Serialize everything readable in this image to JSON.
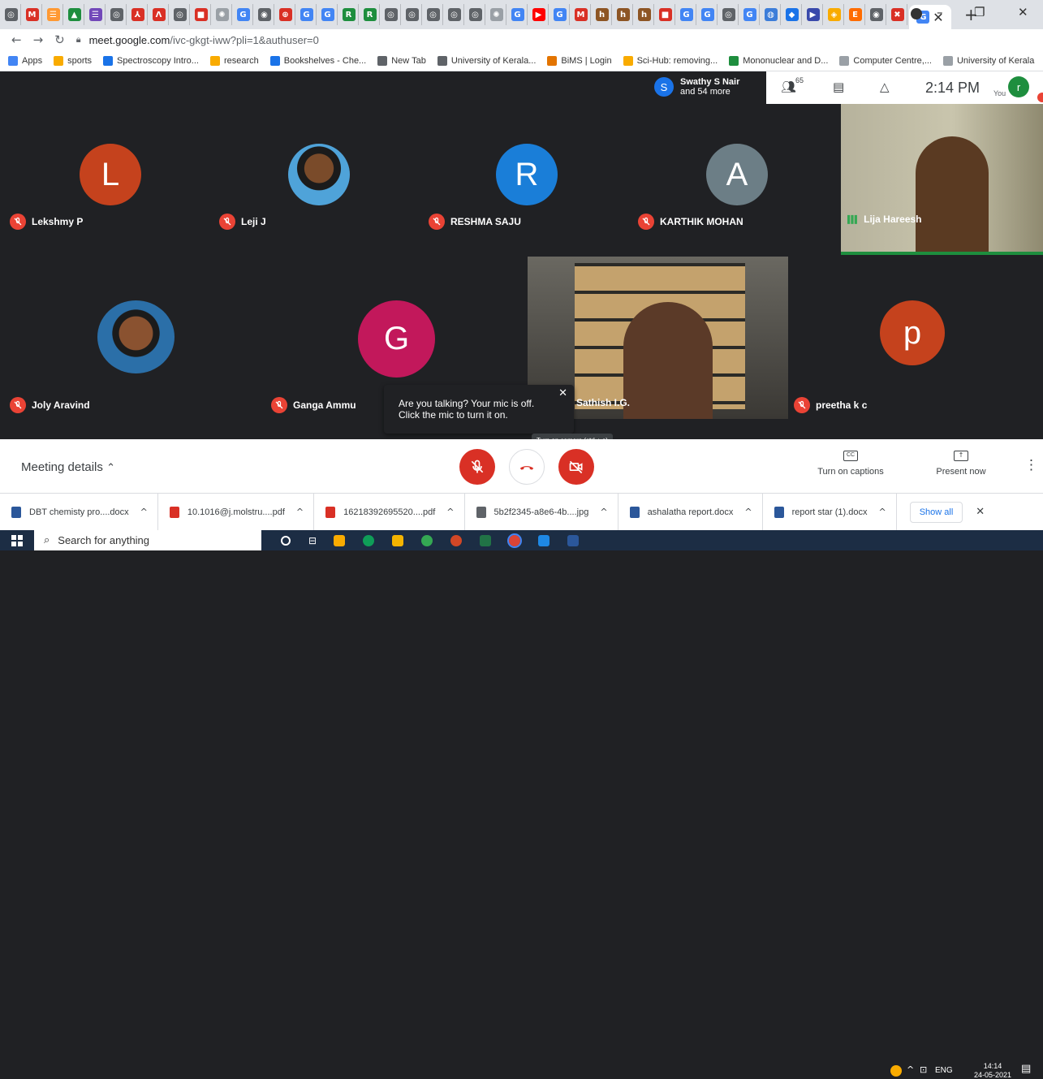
{
  "browser": {
    "tab_favicons": [
      {
        "icon": "chrome-icon",
        "color": "#5f6368",
        "glyph": "◎"
      },
      {
        "icon": "gmail-icon",
        "color": "#d93025",
        "glyph": "M"
      },
      {
        "icon": "india-flag-icon",
        "color": "#ff9933",
        "glyph": "☰"
      },
      {
        "icon": "drive-icon",
        "color": "#1e8e3e",
        "glyph": "▲"
      },
      {
        "icon": "forms-icon",
        "color": "#7248b9",
        "glyph": "☰"
      },
      {
        "icon": "chrome-icon",
        "color": "#5f6368",
        "glyph": "◎"
      },
      {
        "icon": "pdf-icon",
        "color": "#d93025",
        "glyph": "⅄"
      },
      {
        "icon": "acrobat-icon",
        "color": "#d93025",
        "glyph": "Λ"
      },
      {
        "icon": "chrome-icon",
        "color": "#5f6368",
        "glyph": "◎"
      },
      {
        "icon": "news-icon",
        "color": "#d93025",
        "glyph": "■"
      },
      {
        "icon": "seal-icon",
        "color": "#9aa0a6",
        "glyph": "✺"
      },
      {
        "icon": "google-icon",
        "color": "#4285f4",
        "glyph": "G"
      },
      {
        "icon": "meet-icon",
        "color": "#5f6368",
        "glyph": "◉"
      },
      {
        "icon": "seal-icon",
        "color": "#d93025",
        "glyph": "⊕"
      },
      {
        "icon": "google-icon",
        "color": "#4285f4",
        "glyph": "G"
      },
      {
        "icon": "google-icon",
        "color": "#4285f4",
        "glyph": "G"
      },
      {
        "icon": "researchgate-icon",
        "color": "#1e8e3e",
        "glyph": "R"
      },
      {
        "icon": "researchgate-icon",
        "color": "#1e8e3e",
        "glyph": "R"
      },
      {
        "icon": "chrome-icon",
        "color": "#5f6368",
        "glyph": "◎"
      },
      {
        "icon": "chrome-icon",
        "color": "#5f6368",
        "glyph": "◎"
      },
      {
        "icon": "chrome-icon",
        "color": "#5f6368",
        "glyph": "◎"
      },
      {
        "icon": "chrome-icon",
        "color": "#5f6368",
        "glyph": "◎"
      },
      {
        "icon": "chrome-icon",
        "color": "#5f6368",
        "glyph": "◎"
      },
      {
        "icon": "seal-icon",
        "color": "#9aa0a6",
        "glyph": "✺"
      },
      {
        "icon": "google-icon",
        "color": "#4285f4",
        "glyph": "G"
      },
      {
        "icon": "youtube-icon",
        "color": "#ff0000",
        "glyph": "▶"
      },
      {
        "icon": "google-icon",
        "color": "#4285f4",
        "glyph": "G"
      },
      {
        "icon": "gmail-icon",
        "color": "#d93025",
        "glyph": "M"
      },
      {
        "icon": "h-icon",
        "color": "#8d5524",
        "glyph": "h"
      },
      {
        "icon": "h-icon",
        "color": "#8d5524",
        "glyph": "h"
      },
      {
        "icon": "h-icon",
        "color": "#8d5524",
        "glyph": "h"
      },
      {
        "icon": "site-icon",
        "color": "#d93025",
        "glyph": "■"
      },
      {
        "icon": "google-icon",
        "color": "#4285f4",
        "glyph": "G"
      },
      {
        "icon": "google-icon",
        "color": "#4285f4",
        "glyph": "G"
      },
      {
        "icon": "chrome-icon",
        "color": "#5f6368",
        "glyph": "◎"
      },
      {
        "icon": "google-icon",
        "color": "#4285f4",
        "glyph": "G"
      },
      {
        "icon": "site-icon",
        "color": "#3c7dd9",
        "glyph": "◍"
      },
      {
        "icon": "site-icon",
        "color": "#1a73e8",
        "glyph": "◆"
      },
      {
        "icon": "site-icon",
        "color": "#3949ab",
        "glyph": "▶"
      },
      {
        "icon": "scihub-icon",
        "color": "#f9ab00",
        "glyph": "◈"
      },
      {
        "icon": "elsevier-icon",
        "color": "#ff6c00",
        "glyph": "E"
      },
      {
        "icon": "meet-icon",
        "color": "#5f6368",
        "glyph": "◉"
      },
      {
        "icon": "site-icon",
        "color": "#d93025",
        "glyph": "✖"
      },
      {
        "icon": "google-icon",
        "color": "#4285f4",
        "glyph": "G"
      }
    ],
    "new_tab_label": "+",
    "url_host": "meet.google.com",
    "url_path": "/ivc-gkgt-iww?pli=1&authuser=0",
    "profile_letter": "r",
    "bookmarks": [
      {
        "label": "Apps",
        "color": "#4285f4"
      },
      {
        "label": "sports",
        "color": "#f9ab00"
      },
      {
        "label": "Spectroscopy Intro...",
        "color": "#1a73e8"
      },
      {
        "label": "research",
        "color": "#f9ab00"
      },
      {
        "label": "Bookshelves - Che...",
        "color": "#1a73e8"
      },
      {
        "label": "New Tab",
        "color": "#5f6368"
      },
      {
        "label": "University of Kerala...",
        "color": "#5f6368"
      },
      {
        "label": "BiMS | Login",
        "color": "#e37400"
      },
      {
        "label": "Sci-Hub: removing...",
        "color": "#f9ab00"
      },
      {
        "label": "Mononuclear and D...",
        "color": "#1e8e3e"
      },
      {
        "label": "Computer Centre,...",
        "color": "#9aa0a6"
      },
      {
        "label": "University of Kerala",
        "color": "#9aa0a6"
      }
    ]
  },
  "meet": {
    "top_info": {
      "avatar_letter": "S",
      "name": "Swathy S Nair",
      "more": "and 54 more"
    },
    "participant_count": "65",
    "clock": "2:14 PM",
    "self_label": "You",
    "self_letter": "r",
    "participants": [
      {
        "name": "Lekshmy P",
        "letter": "L",
        "color": "#c5421d"
      },
      {
        "name": "Leji J",
        "letter": "",
        "color": ""
      },
      {
        "name": "RESHMA SAJU",
        "letter": "R",
        "color": "#1a7ed8"
      },
      {
        "name": "KARTHIK MOHAN",
        "letter": "A",
        "color": "#6c7e86"
      },
      {
        "name": "Lija Hareesh",
        "letter": "",
        "color": ""
      },
      {
        "name": "Joly Aravind",
        "letter": "",
        "color": ""
      },
      {
        "name": "Ganga Ammu",
        "letter": "G",
        "color": "#c2185b"
      },
      {
        "name": "Sathish I.G.",
        "letter": "",
        "color": ""
      },
      {
        "name": "preetha k c",
        "letter": "p",
        "color": "#c5421d"
      }
    ],
    "tooltip_text": "Are you talking? Your mic is off. Click the mic to turn it on.",
    "camera_tooltip": "Turn on camera (ctrl + e)",
    "meeting_details": "Meeting details",
    "captions_label": "Turn on captions",
    "present_label": "Present now"
  },
  "downloads": [
    {
      "name": "DBT chemisty pro....docx",
      "type": "doc",
      "color": "#2b579a"
    },
    {
      "name": "10.1016@j.molstru....pdf",
      "type": "pdf",
      "color": "#d93025"
    },
    {
      "name": "16218392695520....pdf",
      "type": "pdf",
      "color": "#d93025"
    },
    {
      "name": "5b2f2345-a8e6-4b....jpg",
      "type": "img",
      "color": "#5f6368"
    },
    {
      "name": "ashalatha report.docx",
      "type": "doc",
      "color": "#2b579a"
    },
    {
      "name": "report star (1).docx",
      "type": "doc",
      "color": "#2b579a"
    }
  ],
  "show_all": "Show all",
  "taskbar": {
    "search_placeholder": "Search for anything",
    "lang": "ENG",
    "time": "14:14",
    "date": "24-05-2021"
  }
}
